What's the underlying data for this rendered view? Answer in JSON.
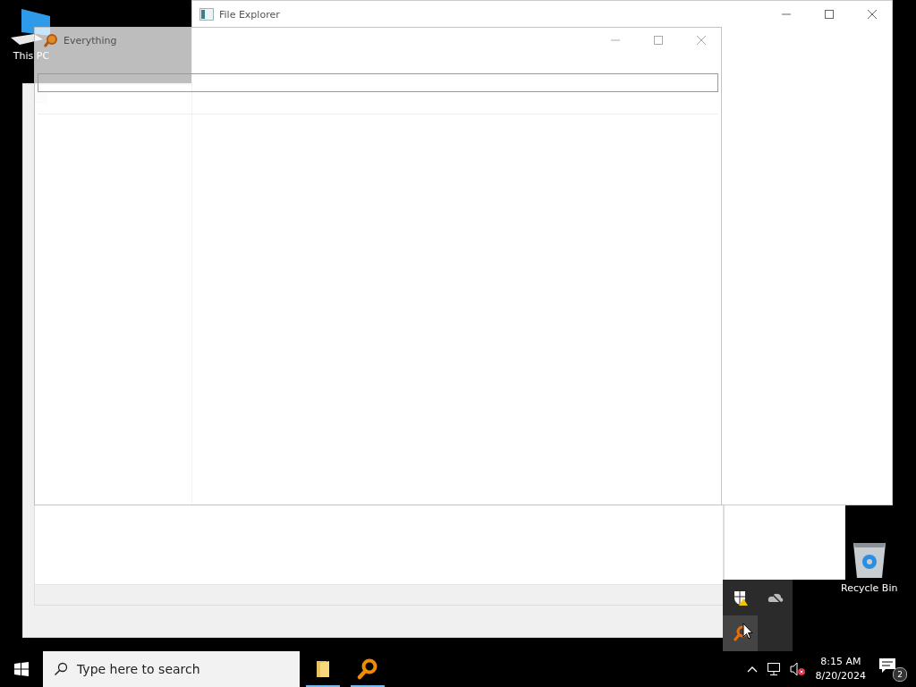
{
  "desktop_icons": [
    {
      "kind": "computer",
      "label": "This PC"
    },
    {
      "kind": "recycle-bin",
      "label": "Recycle Bin"
    }
  ],
  "windows": [
    {
      "kind": "explorer-back"
    },
    {
      "kind": "explorer",
      "title": "File Explorer"
    },
    {
      "kind": "everything",
      "title": "Everything"
    }
  ],
  "tray_overflow": {
    "items": [
      {
        "kind": "security",
        "selected": false
      },
      {
        "kind": "cloud",
        "selected": false
      },
      {
        "kind": "everything",
        "selected": true
      }
    ]
  },
  "taskbar": {
    "search": {
      "placeholder": "Type here to search"
    },
    "apps": [
      {
        "kind": "folder",
        "running": true
      },
      {
        "kind": "everything",
        "running": true
      }
    ],
    "clock": {
      "time": "8:15 AM",
      "date": "8/20/2024"
    },
    "notifications": {
      "count": "2"
    }
  }
}
